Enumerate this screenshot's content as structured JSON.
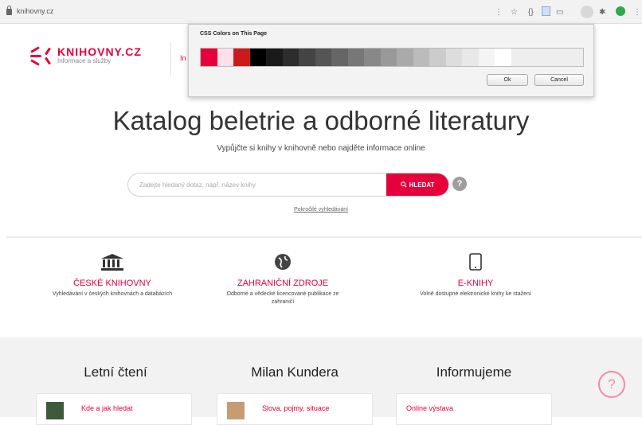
{
  "browser": {
    "url": "knihovny.cz"
  },
  "header": {
    "logo_name": "KNIHOVNY.CZ",
    "logo_sub": "Informace a služby",
    "partial_link": "In"
  },
  "hero": {
    "title": "Katalog beletrie a odborné literatury",
    "subtitle": "Vypůjčte si knihy v knihovně nebo najděte informace online",
    "search_placeholder": "Zadejte hledaný dotaz, např. název knihy",
    "search_button": "HLEDAT",
    "help_label": "?",
    "advanced_link": "Pokročilé vyhledávání"
  },
  "categories": [
    {
      "icon": "library-building-icon",
      "title": "ČESKÉ KNIHOVNY",
      "desc": "Vyhledávání v českých knihovnách a databázích"
    },
    {
      "icon": "globe-icon",
      "title": "ZAHRANIČNÍ ZDROJE",
      "desc": "Odborné a vědecké licencované publikace ze zahraničí"
    },
    {
      "icon": "tablet-icon",
      "title": "E-KNIHY",
      "desc": "Volně dostupné elektronické knihy ke stažení"
    }
  ],
  "bottom": {
    "columns": [
      {
        "title": "Letní čtení",
        "card": "Kde a jak hledat"
      },
      {
        "title": "Milan Kundera",
        "card": "Slova, pojmy, situace"
      },
      {
        "title": "Informujeme",
        "card": "Online výstava"
      }
    ],
    "chat_icon": "chat-question-icon",
    "chat_label": "?"
  },
  "popup": {
    "title": "CSS Colors on This Page",
    "ok_label": "Ok",
    "cancel_label": "Cancel",
    "swatch_colors": [
      "#e6003c",
      "#fde0e8",
      "#cc1a1a",
      "#000000",
      "#1a1a1a",
      "#2d2d2d",
      "#444444",
      "#555555",
      "#666666",
      "#777777",
      "#888888",
      "#999999",
      "#aaaaaa",
      "#bbbbbb",
      "#cccccc",
      "#dddddd",
      "#e8e8e8",
      "#f4f4f4",
      "#ffffff",
      "#eeeeee"
    ]
  },
  "colors": {
    "accent": "#e6003c",
    "help_grey": "#9e9e9e",
    "section_bg": "#f2f2f2"
  }
}
